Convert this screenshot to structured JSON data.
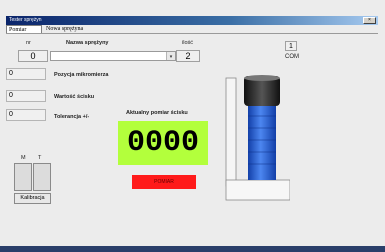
{
  "window": {
    "title": "Tester sprężyn"
  },
  "tabs": [
    {
      "label": "Pomiar",
      "active": true
    },
    {
      "label": "Nowa sprężyna",
      "active": false
    }
  ],
  "fields": {
    "nr_label": "nr",
    "nr_value": "0",
    "spring_name_label": "Nazwa sprężyny",
    "spring_name_value": "",
    "qty_label": "ilość",
    "qty_value": "2",
    "micrometer_label": "Pozycja mikromierza",
    "micrometer_value": "0",
    "compression_label": "Wartość ścisku",
    "compression_value": "0",
    "tolerance_label": "Tolerancja +/-",
    "tolerance_value": "0"
  },
  "com": {
    "number": "1",
    "label": "COM"
  },
  "measurement": {
    "label": "Aktualny pomiar ścisku",
    "value": "0000",
    "button_label": "POMIAR"
  },
  "calibration": {
    "col_m": "M",
    "col_t": "T",
    "button_label": "Kalibracja"
  },
  "colors": {
    "display_bg": "#b3ff3c",
    "button_red": "#ff1a1a",
    "spring_blue": "#2f63d8",
    "titlebar": "#0a246a"
  }
}
